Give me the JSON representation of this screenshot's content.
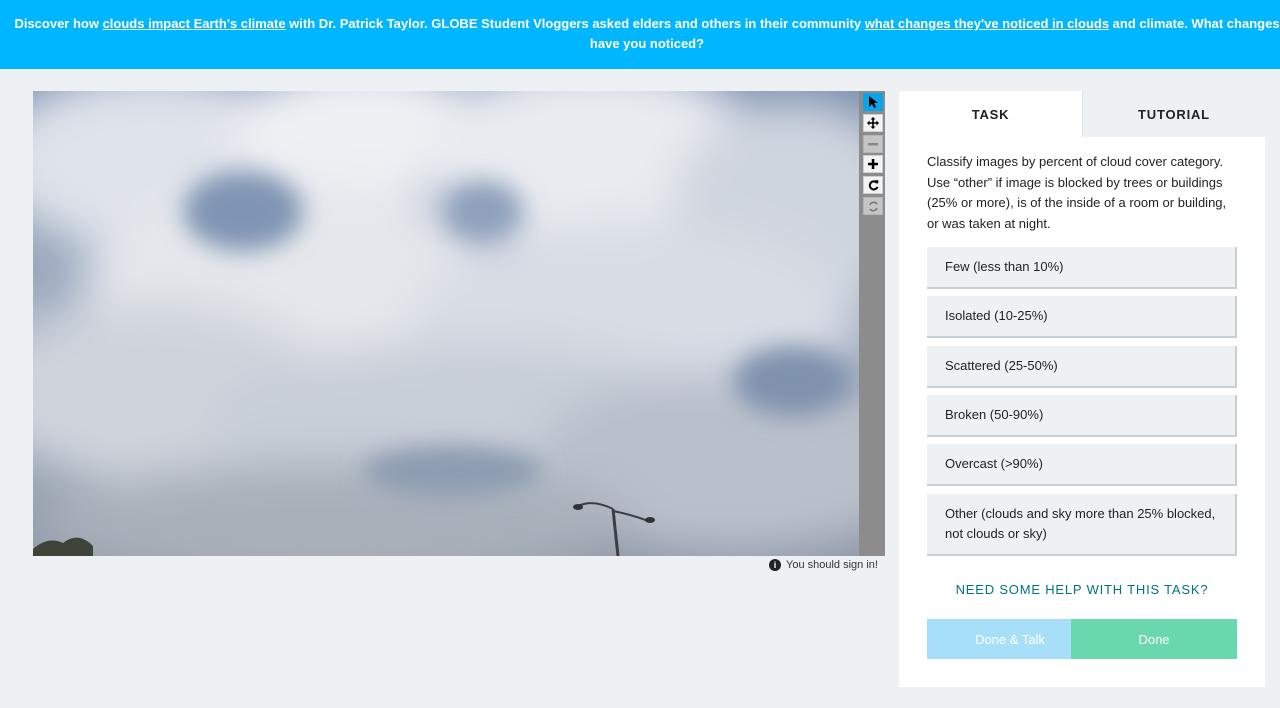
{
  "banner": {
    "part1": "Discover how ",
    "link1": "clouds impact Earth's climate",
    "part2": " with Dr. Patrick Taylor. GLOBE Student Vloggers asked elders and others in their community ",
    "link2": "what changes they've noticed in clouds",
    "part3": " and climate. What changes have you noticed?"
  },
  "viewer": {
    "tools": [
      "pointer-icon",
      "move-icon",
      "zoom-out-icon",
      "zoom-in-icon",
      "rotate-icon",
      "reset-icon"
    ],
    "signin_text": "You should sign in!"
  },
  "panel": {
    "tabs": {
      "task": "TASK",
      "tutorial": "TUTORIAL"
    },
    "instructions": "Classify images by percent of cloud cover category. Use “other” if image is blocked by trees or buildings (25% or more), is of the inside of a room or building, or was taken at night.",
    "answers": [
      "Few (less than 10%)",
      "Isolated (10-25%)",
      "Scattered (25-50%)",
      "Broken (50-90%)",
      "Overcast (>90%)",
      "Other (clouds and sky more than 25% blocked, not clouds or sky)"
    ],
    "help": "NEED SOME HELP WITH THIS TASK?",
    "done_talk": "Done & Talk",
    "done": "Done"
  },
  "colors": {
    "banner": "#00b6ff",
    "accent_tool": "#0aa5e8",
    "done_talk": "#a8dff8",
    "done": "#69d9ad",
    "help_link": "#00737e"
  }
}
